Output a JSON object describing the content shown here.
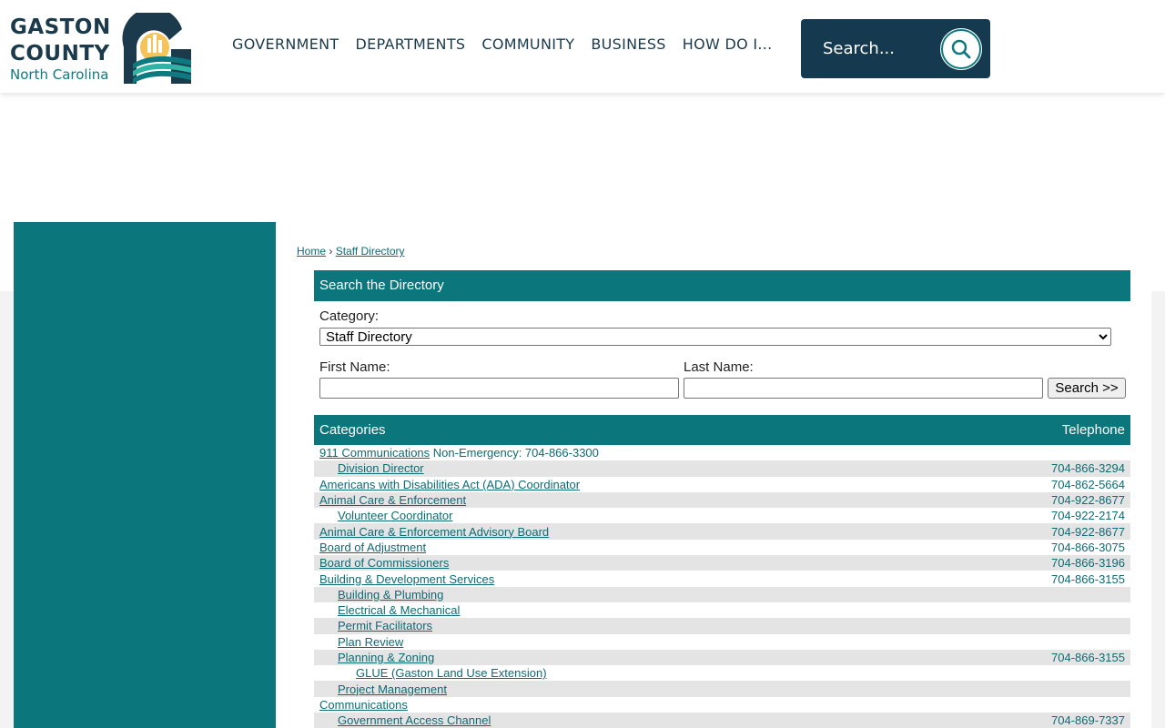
{
  "header": {
    "logo": {
      "line1": "GASTON",
      "line2": "COUNTY",
      "line3": "North Carolina"
    },
    "nav": [
      {
        "label": "GOVERNMENT"
      },
      {
        "label": "DEPARTMENTS"
      },
      {
        "label": "COMMUNITY"
      },
      {
        "label": "BUSINESS"
      },
      {
        "label": "HOW DO I..."
      }
    ],
    "search": {
      "placeholder": "Search..."
    }
  },
  "breadcrumb": {
    "home": "Home",
    "separator": "›",
    "current": "Staff Directory"
  },
  "search_panel": {
    "title": "Search the Directory",
    "category_label": "Category:",
    "category_value": "Staff Directory",
    "first_name_label": "First Name:",
    "last_name_label": "Last Name:",
    "first_name_value": "",
    "last_name_value": "",
    "search_button": "Search >>"
  },
  "directory": {
    "header_categories": "Categories",
    "header_telephone": "Telephone",
    "rows": [
      {
        "name": "911 Communications",
        "extra": "Non-Emergency: 704-866-3300",
        "tel": "",
        "level": 0
      },
      {
        "name": "Division Director",
        "extra": "",
        "tel": "704-866-3294",
        "level": 1
      },
      {
        "name": "Americans with Disabilities Act (ADA) Coordinator",
        "extra": "",
        "tel": "704-862-5664",
        "level": 0
      },
      {
        "name": "Animal Care & Enforcement",
        "extra": "",
        "tel": "704-922-8677",
        "level": 0
      },
      {
        "name": "Volunteer Coordinator",
        "extra": "",
        "tel": "704-922-2174",
        "level": 1
      },
      {
        "name": "Animal Care & Enforcement Advisory Board",
        "extra": "",
        "tel": "704-922-8677",
        "level": 0
      },
      {
        "name": "Board of Adjustment",
        "extra": "",
        "tel": "704-866-3075",
        "level": 0
      },
      {
        "name": "Board of Commissioners",
        "extra": "",
        "tel": "704-866-3196",
        "level": 0
      },
      {
        "name": "Building & Development Services",
        "extra": "",
        "tel": "704-866-3155",
        "level": 0
      },
      {
        "name": "Building & Plumbing",
        "extra": "",
        "tel": "",
        "level": 1
      },
      {
        "name": "Electrical & Mechanical",
        "extra": "",
        "tel": "",
        "level": 1
      },
      {
        "name": "Permit Facilitators",
        "extra": "",
        "tel": "",
        "level": 1
      },
      {
        "name": "Plan Review",
        "extra": "",
        "tel": "",
        "level": 1
      },
      {
        "name": "Planning & Zoning",
        "extra": "",
        "tel": "704-866-3155",
        "level": 1
      },
      {
        "name": "GLUE (Gaston Land Use Extension)",
        "extra": "",
        "tel": "",
        "level": 2
      },
      {
        "name": "Project Management",
        "extra": "",
        "tel": "",
        "level": 1
      },
      {
        "name": "Communications",
        "extra": "",
        "tel": "",
        "level": 0
      },
      {
        "name": "Government Access Channel",
        "extra": "",
        "tel": "704-869-7337",
        "level": 1
      }
    ]
  },
  "colors": {
    "teal": "#0b777d",
    "navy": "#153a4f",
    "link": "#0e6a73"
  }
}
